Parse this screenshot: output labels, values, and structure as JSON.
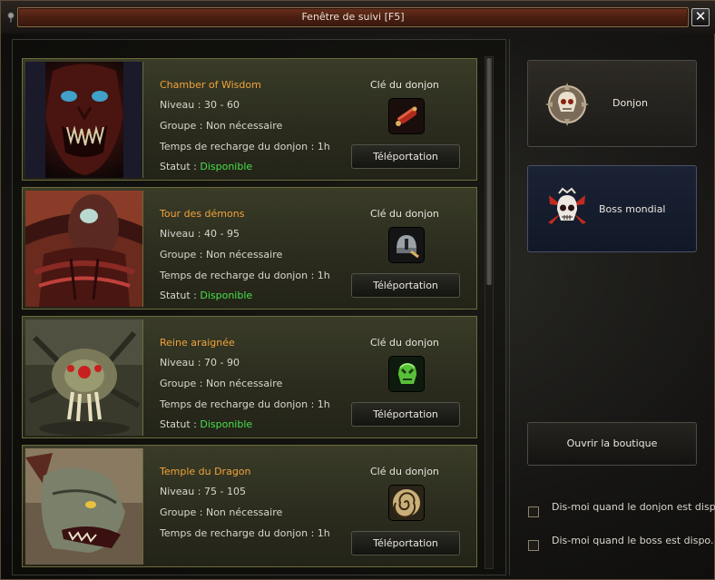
{
  "window": {
    "title": "Fenêtre de suivi [F5]",
    "close_symbol": "✕"
  },
  "dungeons": [
    {
      "name": "Chamber of Wisdom",
      "level_label": "Niveau : ",
      "level": "30 - 60",
      "group_label": "Groupe : ",
      "group": "Non nécessaire",
      "cooldown_label": "Temps de recharge du donjon : ",
      "cooldown": "1h",
      "status_label": "Statut : ",
      "status": "Disponible",
      "key_label": "Clé du donjon",
      "key_icon": "scroll-key-icon",
      "teleport_label": "Téléportation"
    },
    {
      "name": "Tour des démons",
      "level_label": "Niveau : ",
      "level": "40 - 95",
      "group_label": "Groupe : ",
      "group": "Non nécessaire",
      "cooldown_label": "Temps de recharge du donjon : ",
      "cooldown": "1h",
      "status_label": "Statut : ",
      "status": "Disponible",
      "key_label": "Clé du donjon",
      "key_icon": "helmet-key-icon",
      "teleport_label": "Téléportation"
    },
    {
      "name": "Reine araignée",
      "level_label": "Niveau : ",
      "level": "70 - 90",
      "group_label": "Groupe : ",
      "group": "Non nécessaire",
      "cooldown_label": "Temps de recharge du donjon : ",
      "cooldown": "1h",
      "status_label": "Statut : ",
      "status": "Disponible",
      "key_label": "Clé du donjon",
      "key_icon": "green-skull-key-icon",
      "teleport_label": "Téléportation"
    },
    {
      "name": "Temple du Dragon",
      "level_label": "Niveau : ",
      "level": "75 - 105",
      "group_label": "Groupe : ",
      "group": "Non nécessaire",
      "cooldown_label": "Temps de recharge du donjon : ",
      "cooldown": "1h",
      "key_label": "Clé du donjon",
      "key_icon": "spiral-key-icon",
      "teleport_label": "Téléportation"
    }
  ],
  "sidebar": {
    "donjon_label": "Donjon",
    "boss_label": "Boss mondial",
    "shop_label": "Ouvrir la boutique",
    "notify_dungeon": "Dis-moi quand le donjon est disponible",
    "notify_boss": "Dis-moi quand le boss est dispo."
  },
  "colors": {
    "dungeon_name": "#f0a33a",
    "status_available": "#48e048",
    "title_bar": "#5a2616"
  }
}
